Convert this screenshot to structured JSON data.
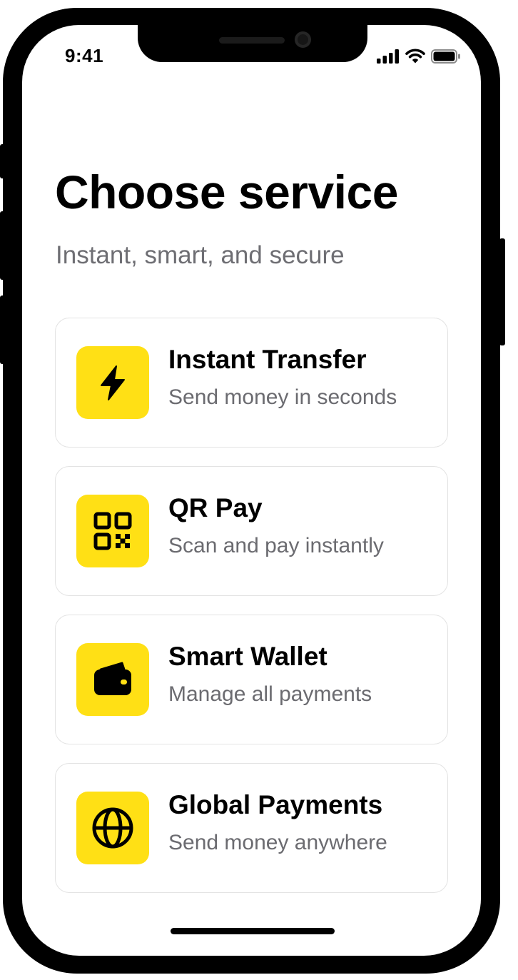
{
  "status_bar": {
    "time": "9:41",
    "icons": [
      "cellular-signal-icon",
      "wifi-icon",
      "battery-icon"
    ]
  },
  "header": {
    "title": "Choose service",
    "subtitle": "Instant, smart, and secure"
  },
  "services": [
    {
      "title": "Instant Transfer",
      "description": "Send money in seconds",
      "icon": "lightning-bolt-icon"
    },
    {
      "title": "QR Pay",
      "description": "Scan and pay instantly",
      "icon": "qr-code-icon"
    },
    {
      "title": "Smart Wallet",
      "description": "Manage all payments",
      "icon": "wallet-icon"
    },
    {
      "title": "Global Payments",
      "description": "Send money anywhere",
      "icon": "globe-icon"
    }
  ],
  "colors": {
    "accent": "#ffe015",
    "title": "#000000",
    "secondary_text": "#6e6e73",
    "card_border": "#e3e3e3",
    "background": "#ffffff"
  }
}
